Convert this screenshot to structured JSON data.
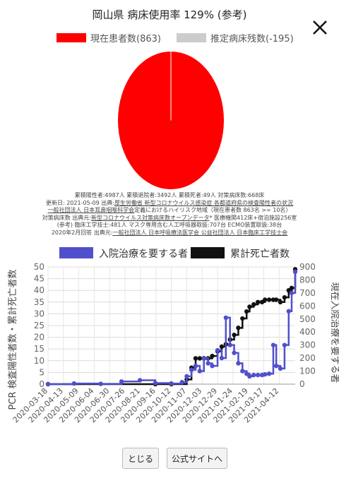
{
  "title": "岡山県 病床使用率 129% (参考)",
  "pie": {
    "legend": [
      {
        "label": "現在患者数(863)",
        "color": "#ff0000"
      },
      {
        "label": "推定病床残数(-195)",
        "color": "#cccccc"
      }
    ],
    "values": [
      863,
      0
    ]
  },
  "stats_lines": [
    [
      {
        "t": "累積陽性者:4987人 累積退院者:3492人 累積死者:49人 対策病床数:668床",
        "u": false
      }
    ],
    [
      {
        "t": "更新日: 2021-05-09 出典:",
        "u": false
      },
      {
        "t": "厚生労働省 新型コロナウイルス感染症 各都道府県の検査陽性者の状況",
        "u": true
      }
    ],
    [
      {
        "t": "一般社団法人 日本耳鼻咽喉科学会",
        "u": true
      },
      {
        "t": "定義におけるハイリスク地域（現在患者数 863名 >= 10名）",
        "u": false
      }
    ],
    [
      {
        "t": "対策病床数 出典元:",
        "u": false
      },
      {
        "t": "新型コロナウイルス対策病床数オープンデータ",
        "u": true
      },
      {
        "t": "* 医療機関412床+宿泊施設256室",
        "u": false
      }
    ],
    [
      {
        "t": "(参考) 臨床工学技士:481人 マスク専用含む人工呼吸器取扱:707台 ECMO装置取扱:38台",
        "u": false
      }
    ],
    [
      {
        "t": "2020年2月回答 出典元:",
        "u": false
      },
      {
        "t": "一般社団法人 日本呼吸療法医学会 公益社団法人 日本臨床工学技士会",
        "u": true
      }
    ]
  ],
  "chart_data": {
    "type": "line",
    "series": [
      {
        "name": "入院治療を要する者",
        "color": "#5050cc",
        "axis": "right",
        "x": [
          "2020-03-18",
          "2020-05-01",
          "2020-06-15",
          "2020-07-20",
          "2020-08-20",
          "2020-09-15",
          "2020-10-12",
          "2020-10-30",
          "2020-11-07",
          "2020-11-15",
          "2020-11-22",
          "2020-11-29",
          "2020-12-06",
          "2020-12-13",
          "2020-12-20",
          "2020-12-29",
          "2021-01-05",
          "2021-01-12",
          "2021-01-19",
          "2021-01-26",
          "2021-02-02",
          "2021-02-09",
          "2021-02-16",
          "2021-02-21",
          "2021-02-28",
          "2021-03-07",
          "2021-03-14",
          "2021-03-19",
          "2021-03-26",
          "2021-04-02",
          "2021-04-07",
          "2021-04-14",
          "2021-04-21",
          "2021-04-28",
          "2021-05-03",
          "2021-05-09"
        ],
        "values": [
          0,
          5,
          2,
          20,
          30,
          8,
          5,
          15,
          60,
          110,
          140,
          100,
          200,
          160,
          140,
          260,
          200,
          510,
          300,
          240,
          160,
          100,
          80,
          60,
          70,
          70,
          70,
          75,
          80,
          300,
          140,
          120,
          300,
          560,
          700,
          863
        ]
      },
      {
        "name": "累計死亡者数",
        "color": "#111111",
        "axis": "left",
        "x": [
          "2020-03-18",
          "2020-09-15",
          "2020-10-12",
          "2020-11-07",
          "2020-11-15",
          "2020-11-22",
          "2020-11-29",
          "2020-12-06",
          "2020-12-13",
          "2020-12-20",
          "2020-12-29",
          "2021-01-05",
          "2021-01-12",
          "2021-01-19",
          "2021-01-26",
          "2021-02-02",
          "2021-02-09",
          "2021-02-16",
          "2021-02-21",
          "2021-02-28",
          "2021-03-07",
          "2021-03-14",
          "2021-03-19",
          "2021-03-26",
          "2021-04-02",
          "2021-04-07",
          "2021-04-14",
          "2021-04-21",
          "2021-04-28",
          "2021-05-03",
          "2021-05-09"
        ],
        "values": [
          0,
          0,
          0,
          2,
          7,
          11,
          11,
          11,
          11,
          12,
          14,
          16,
          17,
          19,
          21,
          24,
          28,
          31,
          33,
          34,
          35,
          35,
          36,
          36,
          36,
          36,
          35,
          37,
          40,
          41,
          49
        ]
      }
    ],
    "x_ticks": [
      "2020-03-18",
      "2020-04-13",
      "2020-05-09",
      "2020-06-04",
      "2020-06-30",
      "2020-07-26",
      "2020-08-21",
      "2020-09-16",
      "2020-10-12",
      "2020-11-07",
      "2020-12-03",
      "2020-12-29",
      "2021-01-24",
      "2021-02-19",
      "2021-03-17",
      "2021-04-12"
    ],
    "x_range": [
      "2020-03-18",
      "2021-05-09"
    ],
    "ylabel_left": "PCR 検査陽性者数・累計死亡者数",
    "ylabel_right": "現在入院治療を要する者",
    "ylim_left": [
      0,
      50
    ],
    "ylim_right": [
      0,
      900
    ],
    "yticks_left": [
      0,
      5,
      10,
      15,
      20,
      25,
      30,
      35,
      40,
      45,
      50
    ],
    "yticks_right": [
      0,
      100,
      200,
      300,
      400,
      500,
      600,
      700,
      800,
      900
    ],
    "legend_position": "top",
    "grid": true
  },
  "buttons": {
    "close_label": "とじる",
    "site_label": "公式サイトへ"
  }
}
